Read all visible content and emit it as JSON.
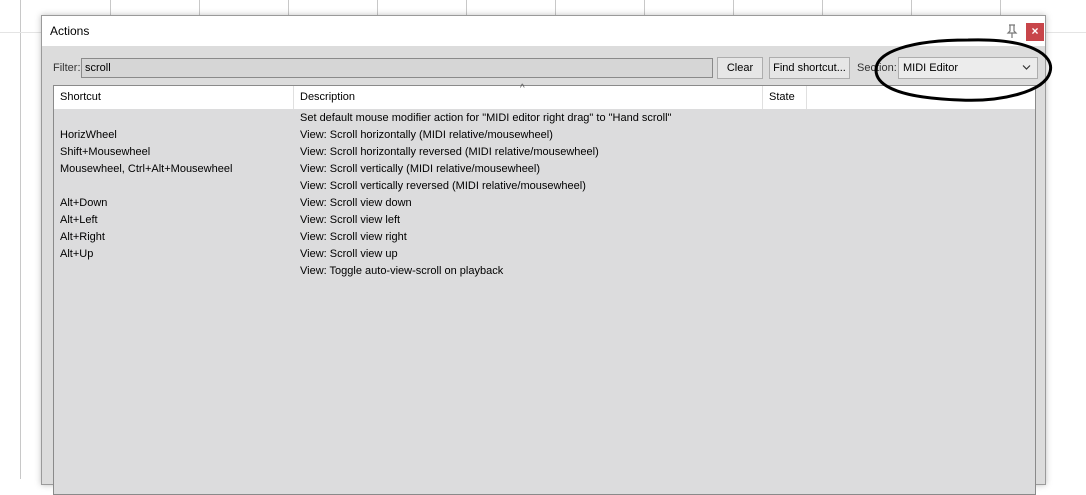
{
  "dialog": {
    "title": "Actions",
    "close_label": "×"
  },
  "filter": {
    "label": "Filter:",
    "value": "scroll"
  },
  "buttons": {
    "clear": "Clear",
    "find_shortcut": "Find shortcut..."
  },
  "section": {
    "label": "Section:",
    "selected": "MIDI Editor"
  },
  "table": {
    "headers": {
      "shortcut": "Shortcut",
      "description": "Description",
      "state": "State"
    },
    "sort_indicator": "^",
    "rows": [
      {
        "shortcut": "",
        "description": "Set default mouse modifier action for \"MIDI editor right drag\" to \"Hand scroll\""
      },
      {
        "shortcut": "HorizWheel",
        "description": "View: Scroll horizontally (MIDI relative/mousewheel)"
      },
      {
        "shortcut": "Shift+Mousewheel",
        "description": "View: Scroll horizontally reversed (MIDI relative/mousewheel)"
      },
      {
        "shortcut": "Mousewheel, Ctrl+Alt+Mousewheel",
        "description": "View: Scroll vertically (MIDI relative/mousewheel)"
      },
      {
        "shortcut": "",
        "description": "View: Scroll vertically reversed (MIDI relative/mousewheel)"
      },
      {
        "shortcut": "Alt+Down",
        "description": "View: Scroll view down"
      },
      {
        "shortcut": "Alt+Left",
        "description": "View: Scroll view left"
      },
      {
        "shortcut": "Alt+Right",
        "description": "View: Scroll view right"
      },
      {
        "shortcut": "Alt+Up",
        "description": "View: Scroll view up"
      },
      {
        "shortcut": "",
        "description": "View: Toggle auto-view-scroll on playback"
      }
    ]
  },
  "icons": {
    "pin": "pin-icon",
    "close": "close-icon",
    "dropdown": "chevron-down-icon"
  },
  "colors": {
    "close_button": "#c8454a",
    "dialog_background": "#dcdcdc",
    "annotation": "#000000"
  }
}
